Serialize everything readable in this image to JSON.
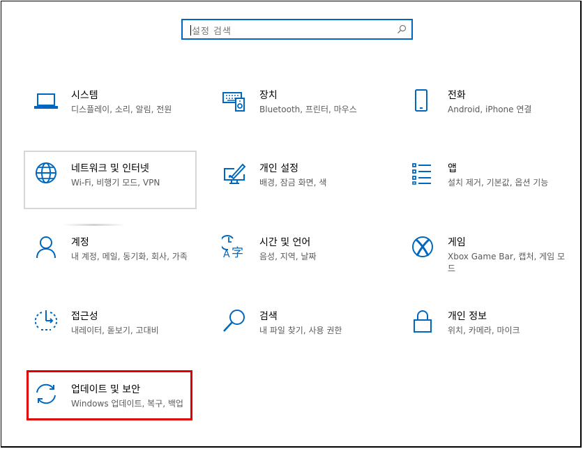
{
  "search": {
    "placeholder": "설정 검색"
  },
  "tiles": [
    {
      "title": "시스템",
      "subtitle": "디스플레이, 소리, 알림, 전원",
      "icon": "laptop-icon"
    },
    {
      "title": "장치",
      "subtitle": "Bluetooth, 프린터, 마우스",
      "icon": "devices-icon"
    },
    {
      "title": "전화",
      "subtitle": "Android, iPhone 연결",
      "icon": "phone-icon"
    },
    {
      "title": "네트워크 및 인터넷",
      "subtitle": "Wi-Fi, 비행기 모드, VPN",
      "icon": "globe-icon"
    },
    {
      "title": "개인 설정",
      "subtitle": "배경, 잠금 화면, 색",
      "icon": "personalization-icon"
    },
    {
      "title": "앱",
      "subtitle": "설치 제거, 기본값, 옵션 기능",
      "icon": "apps-icon"
    },
    {
      "title": "계정",
      "subtitle": "내 계정, 메일, 동기화, 회사, 가족",
      "icon": "account-icon"
    },
    {
      "title": "시간 및 언어",
      "subtitle": "음성, 지역, 날짜",
      "icon": "time-language-icon"
    },
    {
      "title": "게임",
      "subtitle": "Xbox Game Bar, 캡처, 게임 모드",
      "icon": "xbox-icon"
    },
    {
      "title": "접근성",
      "subtitle": "내레이터, 돋보기, 고대비",
      "icon": "accessibility-icon"
    },
    {
      "title": "검색",
      "subtitle": "내 파일 찾기, 사용 권한",
      "icon": "search-icon"
    },
    {
      "title": "개인 정보",
      "subtitle": "위치, 카메라, 마이크",
      "icon": "lock-icon"
    },
    {
      "title": "업데이트 및 보안",
      "subtitle": "Windows 업데이트, 복구, 백업",
      "icon": "update-icon"
    }
  ],
  "colors": {
    "accent": "#0067c0",
    "highlight": "#e00000"
  }
}
